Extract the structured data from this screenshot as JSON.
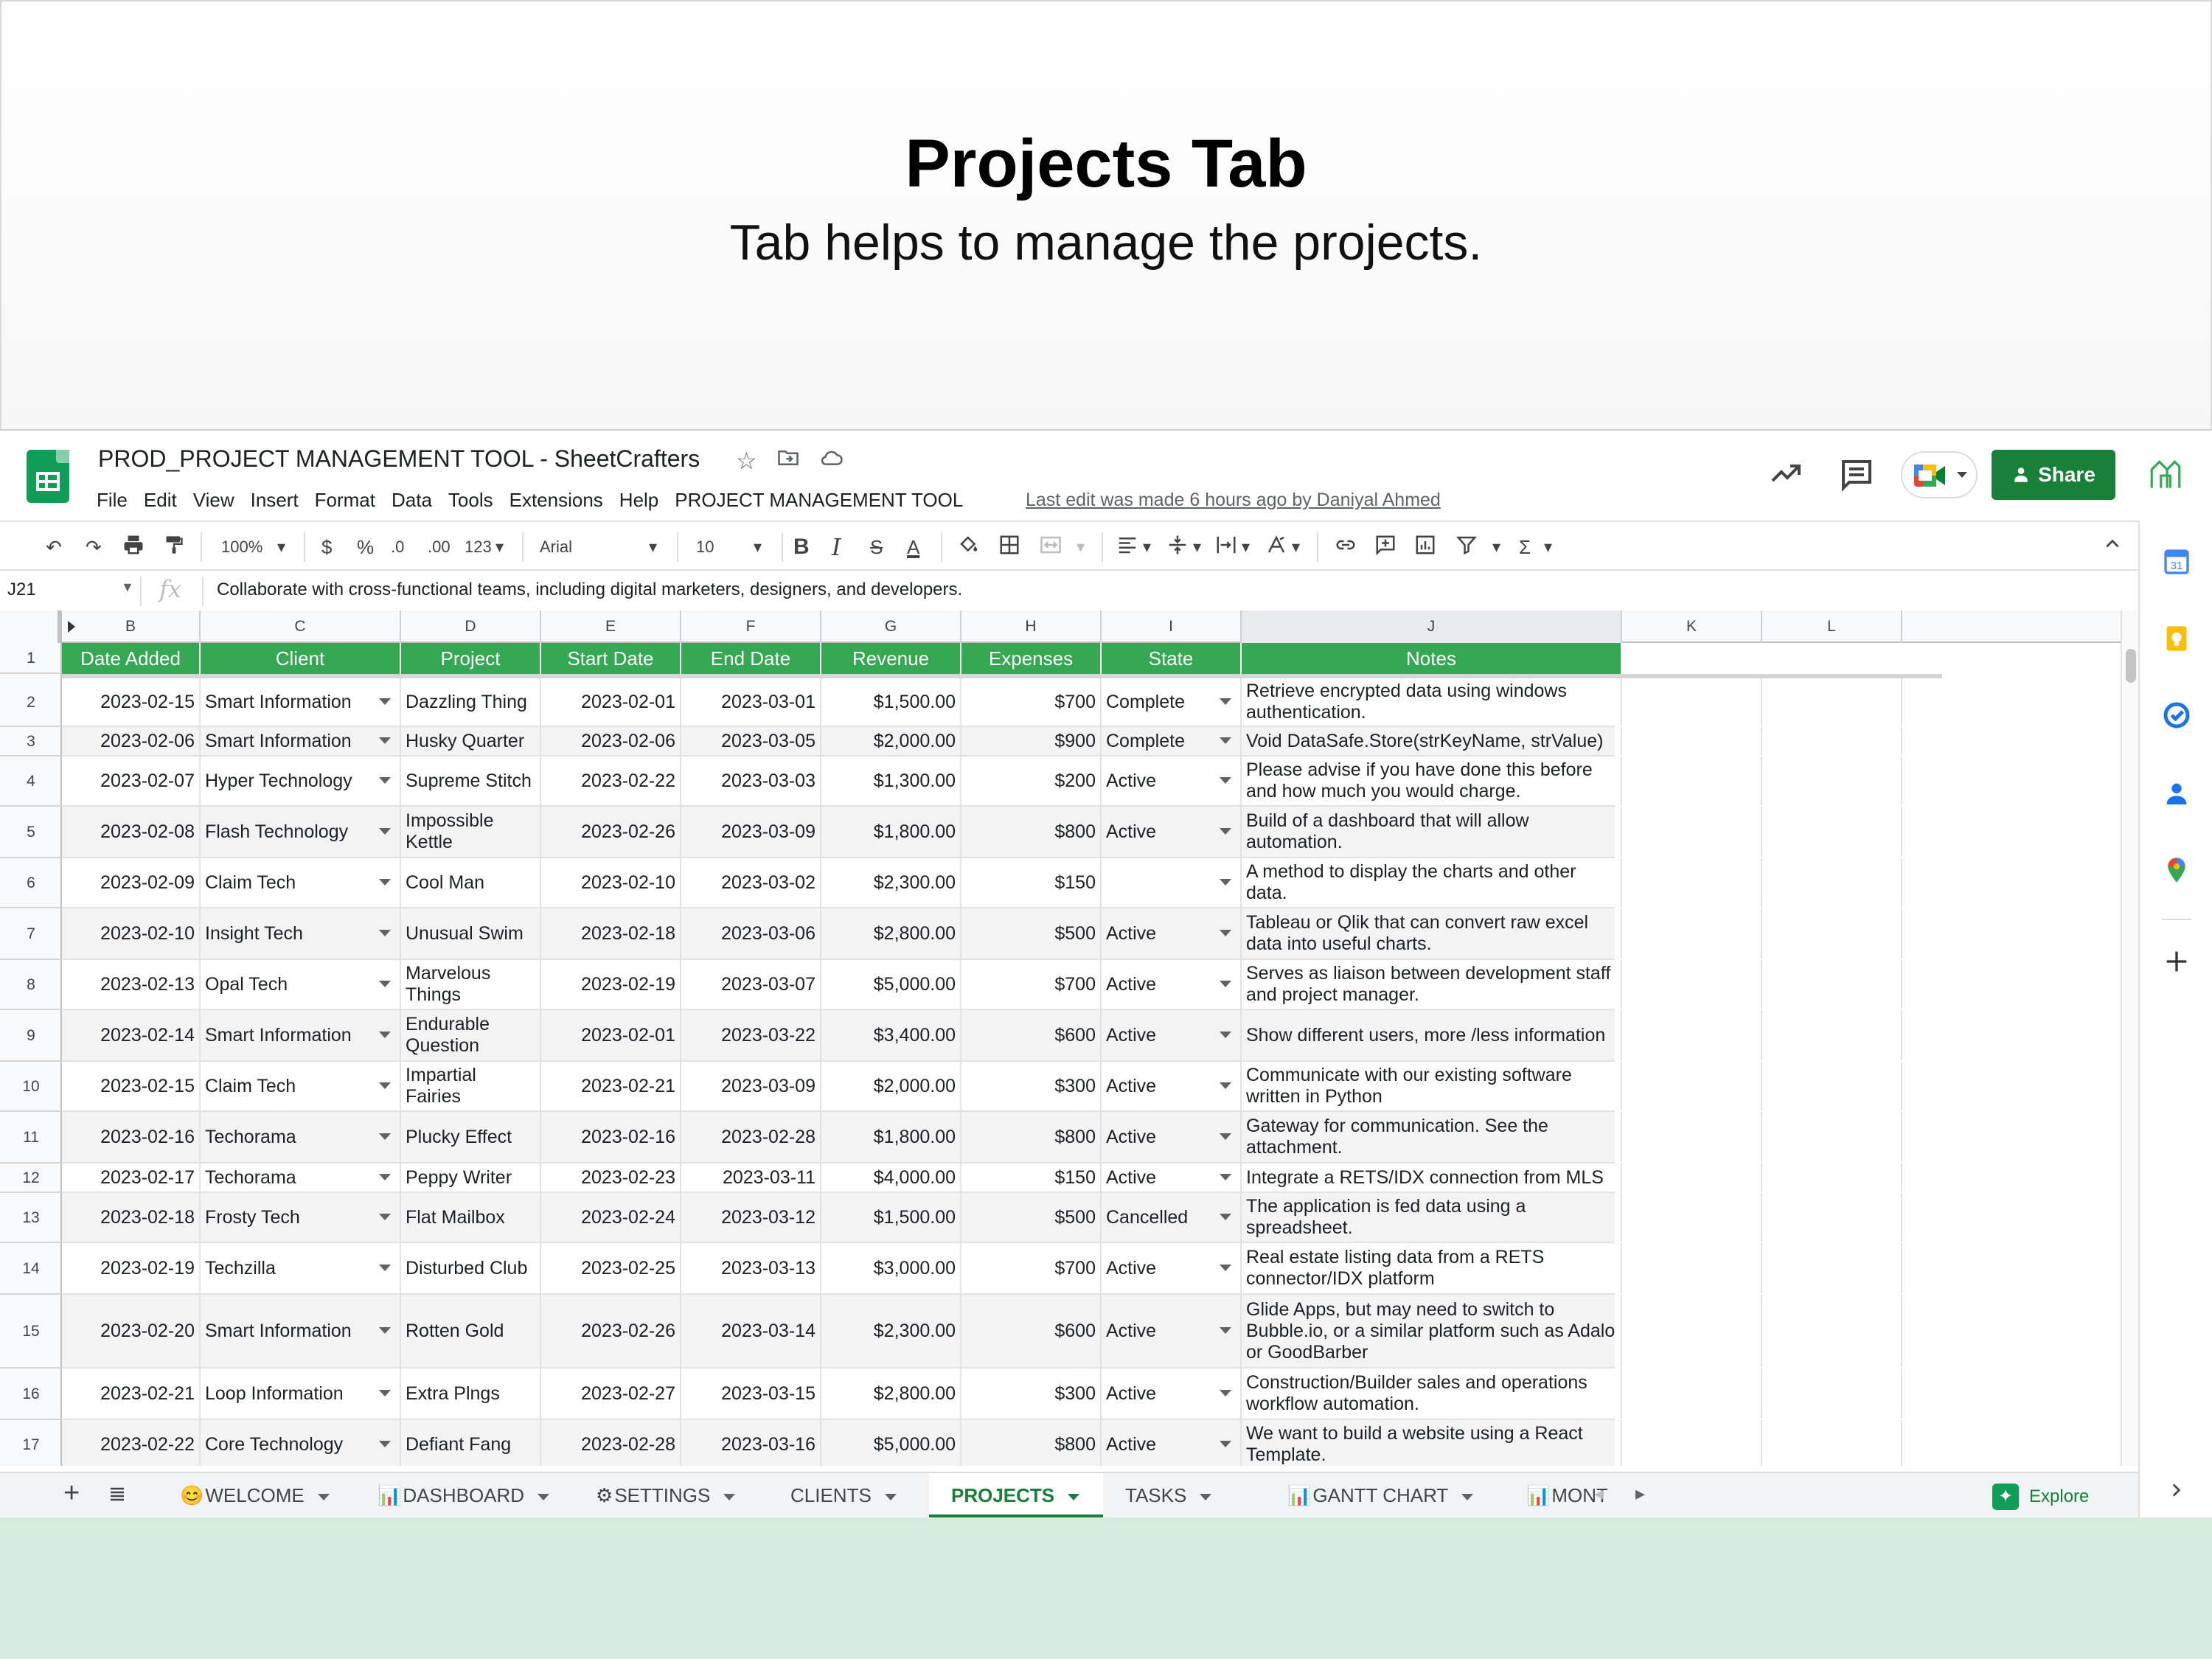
{
  "banner": {
    "title": "Projects Tab",
    "subtitle": "Tab helps to manage the projects."
  },
  "doc": {
    "title": "PROD_PROJECT MANAGEMENT TOOL - SheetCrafters",
    "last_edit": "Last edit was made 6 hours ago by Daniyal Ahmed"
  },
  "menu": [
    "File",
    "Edit",
    "View",
    "Insert",
    "Format",
    "Data",
    "Tools",
    "Extensions",
    "Help",
    "PROJECT MANAGEMENT TOOL"
  ],
  "share_label": "Share",
  "toolbar": {
    "zoom": "100%",
    "currency": "$",
    "percent": "%",
    "dec_less": ".0",
    "dec_more": ".00",
    "number_format": "123",
    "font": "Arial",
    "font_size": "10",
    "bold": "B",
    "italic": "I",
    "strike": "S",
    "text_color": "A",
    "function": "Σ"
  },
  "formula_bar": {
    "cell_ref": "J21",
    "fx": "fx",
    "content": "Collaborate with cross-functional teams, including digital marketers, designers, and developers."
  },
  "columns": [
    "B",
    "C",
    "D",
    "E",
    "F",
    "G",
    "H",
    "I",
    "J",
    "K",
    "L"
  ],
  "selected_column": "J",
  "headers": [
    "Date Added",
    "Client",
    "Project",
    "Start Date",
    "End Date",
    "Revenue",
    "Expenses",
    "State",
    "Notes"
  ],
  "header_row_num": "1",
  "rows": [
    {
      "n": "2",
      "date": "2023-02-15",
      "client": "Smart Information",
      "project": "Dazzling Thing",
      "start": "2023-02-01",
      "end": "2023-03-01",
      "revenue": "$1,500.00",
      "expenses": "$700",
      "state": "Complete",
      "notes": "Retrieve encrypted data using windows authentication."
    },
    {
      "n": "3",
      "date": "2023-02-06",
      "client": "Smart Information",
      "project": "Husky Quarter",
      "start": "2023-02-06",
      "end": "2023-03-05",
      "revenue": "$2,000.00",
      "expenses": "$900",
      "state": "Complete",
      "notes": "Void DataSafe.Store(strKeyName, strValue)"
    },
    {
      "n": "4",
      "date": "2023-02-07",
      "client": "Hyper Technology",
      "project": "Supreme Stitch",
      "start": "2023-02-22",
      "end": "2023-03-03",
      "revenue": "$1,300.00",
      "expenses": "$200",
      "state": "Active",
      "notes": "Please advise if you have done this before and how much you would charge."
    },
    {
      "n": "5",
      "date": "2023-02-08",
      "client": "Flash Technology",
      "project": "Impossible Kettle",
      "start": "2023-02-26",
      "end": "2023-03-09",
      "revenue": "$1,800.00",
      "expenses": "$800",
      "state": "Active",
      "notes": "Build of a dashboard that will allow automation."
    },
    {
      "n": "6",
      "date": "2023-02-09",
      "client": "Claim Tech",
      "project": "Cool Man",
      "start": "2023-02-10",
      "end": "2023-03-02",
      "revenue": "$2,300.00",
      "expenses": "$150",
      "state": "",
      "notes": "A method to display the charts and other data."
    },
    {
      "n": "7",
      "date": "2023-02-10",
      "client": "Insight Tech",
      "project": "Unusual Swim",
      "start": "2023-02-18",
      "end": "2023-03-06",
      "revenue": "$2,800.00",
      "expenses": "$500",
      "state": "Active",
      "notes": "Tableau or Qlik that can convert raw excel data into useful charts."
    },
    {
      "n": "8",
      "date": "2023-02-13",
      "client": "Opal Tech",
      "project": "Marvelous Things",
      "start": "2023-02-19",
      "end": "2023-03-07",
      "revenue": "$5,000.00",
      "expenses": "$700",
      "state": "Active",
      "notes": "Serves as liaison between development staff and project manager."
    },
    {
      "n": "9",
      "date": "2023-02-14",
      "client": "Smart Information",
      "project": "Endurable Question",
      "start": "2023-02-01",
      "end": "2023-03-22",
      "revenue": "$3,400.00",
      "expenses": "$600",
      "state": "Active",
      "notes": "Show different users, more /less information"
    },
    {
      "n": "10",
      "date": "2023-02-15",
      "client": "Claim Tech",
      "project": "Impartial Fairies",
      "start": "2023-02-21",
      "end": "2023-03-09",
      "revenue": "$2,000.00",
      "expenses": "$300",
      "state": "Active",
      "notes": "Communicate with our existing software written in Python"
    },
    {
      "n": "11",
      "date": "2023-02-16",
      "client": "Techorama",
      "project": "Plucky Effect",
      "start": "2023-02-16",
      "end": "2023-02-28",
      "revenue": "$1,800.00",
      "expenses": "$800",
      "state": "Active",
      "notes": "Gateway for communication. See the attachment."
    },
    {
      "n": "12",
      "date": "2023-02-17",
      "client": "Techorama",
      "project": "Peppy Writer",
      "start": "2023-02-23",
      "end": "2023-03-11",
      "revenue": "$4,000.00",
      "expenses": "$150",
      "state": "Active",
      "notes": "Integrate a RETS/IDX connection from MLS"
    },
    {
      "n": "13",
      "date": "2023-02-18",
      "client": "Frosty Tech",
      "project": "Flat Mailbox",
      "start": "2023-02-24",
      "end": "2023-03-12",
      "revenue": "$1,500.00",
      "expenses": "$500",
      "state": "Cancelled",
      "notes": "The application is fed data using a spreadsheet."
    },
    {
      "n": "14",
      "date": "2023-02-19",
      "client": "Techzilla",
      "project": "Disturbed Club",
      "start": "2023-02-25",
      "end": "2023-03-13",
      "revenue": "$3,000.00",
      "expenses": "$700",
      "state": "Active",
      "notes": "Real estate listing data from a RETS connector/IDX platform"
    },
    {
      "n": "15",
      "date": "2023-02-20",
      "client": "Smart Information",
      "project": "Rotten Gold",
      "start": "2023-02-26",
      "end": "2023-03-14",
      "revenue": "$2,300.00",
      "expenses": "$600",
      "state": "Active",
      "notes": "Glide Apps, but may need to switch to Bubble.io, or a similar platform such as Adalo or GoodBarber"
    },
    {
      "n": "16",
      "date": "2023-02-21",
      "client": "Loop Information",
      "project": "Extra Plngs",
      "start": "2023-02-27",
      "end": "2023-03-15",
      "revenue": "$2,800.00",
      "expenses": "$300",
      "state": "Active",
      "notes": "Construction/Builder sales and operations workflow automation."
    },
    {
      "n": "17",
      "date": "2023-02-22",
      "client": "Core Technology",
      "project": "Defiant Fang",
      "start": "2023-02-28",
      "end": "2023-03-16",
      "revenue": "$5,000.00",
      "expenses": "$800",
      "state": "Active",
      "notes": "We want to build a website using a React Template."
    }
  ],
  "sheet_tabs": [
    {
      "label": "WELCOME",
      "icon": "😊"
    },
    {
      "label": "DASHBOARD",
      "icon": "📊"
    },
    {
      "label": "SETTINGS",
      "icon": "⚙"
    },
    {
      "label": "CLIENTS",
      "icon": ""
    },
    {
      "label": "PROJECTS",
      "icon": "",
      "active": true
    },
    {
      "label": "TASKS",
      "icon": ""
    },
    {
      "label": "GANTT CHART",
      "icon": "📊"
    },
    {
      "label": "MONTH",
      "icon": "📊"
    }
  ],
  "explore_label": "Explore",
  "colors": {
    "header_green": "#34a853",
    "share_green": "#188038",
    "bottom_bg": "#d7ecdc"
  }
}
